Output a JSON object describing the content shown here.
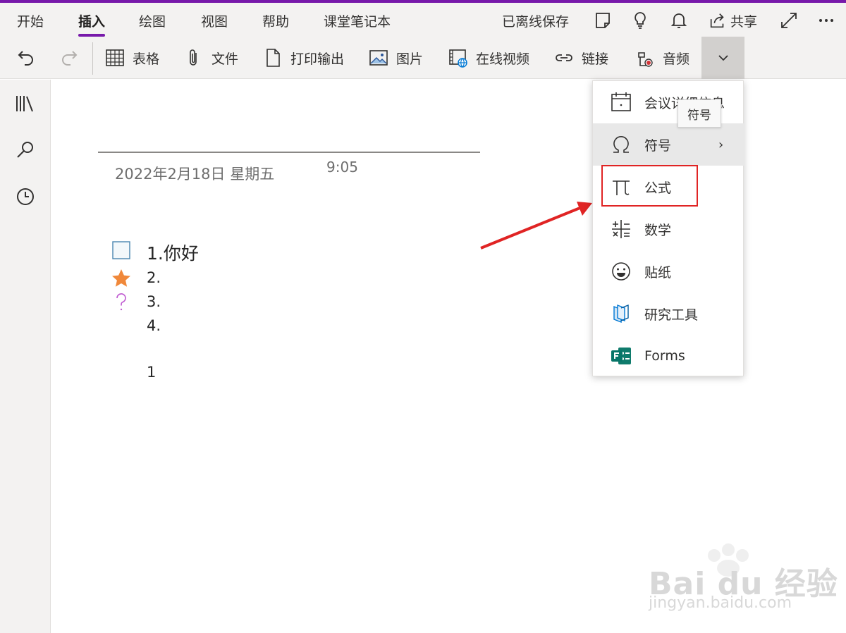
{
  "tabs": [
    {
      "label": "开始"
    },
    {
      "label": "插入"
    },
    {
      "label": "绘图"
    },
    {
      "label": "视图"
    },
    {
      "label": "帮助"
    },
    {
      "label": "课堂笔记本"
    }
  ],
  "status": "已离线保存",
  "share_label": "共享",
  "ribbon": {
    "table": "表格",
    "file": "文件",
    "printout": "打印输出",
    "picture": "图片",
    "online_video": "在线视频",
    "link": "链接",
    "audio": "音频"
  },
  "note": {
    "date": "2022年2月18日 星期五",
    "time": "9:05",
    "lines": [
      "1.你好",
      "2.",
      "3.",
      "4.",
      "1"
    ]
  },
  "menu": {
    "items": [
      {
        "label": "会议详细信息",
        "icon": "calendar-icon"
      },
      {
        "label": "符号",
        "icon": "omega-icon"
      },
      {
        "label": "公式",
        "icon": "pi-icon"
      },
      {
        "label": "数学",
        "icon": "math-icon"
      },
      {
        "label": "贴纸",
        "icon": "smiley-icon"
      },
      {
        "label": "研究工具",
        "icon": "researcher-icon"
      },
      {
        "label": "Forms",
        "icon": "forms-icon"
      }
    ],
    "tooltip": "符号"
  },
  "watermark": {
    "brand": "Bai du 经验",
    "url": "jingyan.baidu.com"
  },
  "colors": {
    "accent": "#7719aa",
    "highlight": "#e02424",
    "star": "#f0883a",
    "question": "#c05bd1",
    "forms_green": "#0f7b6c"
  }
}
